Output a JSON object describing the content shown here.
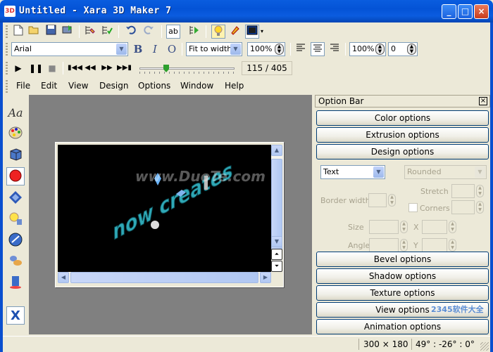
{
  "window": {
    "icon_text": "3D",
    "title": "Untitled - Xara 3D Maker 7",
    "minimize": "_",
    "maximize": "□",
    "close": "×"
  },
  "toolbar": {
    "icons": [
      "new-file-icon",
      "open-file-icon",
      "save-icon",
      "export-icon",
      "wizard-icon",
      "style-icon",
      "undo-icon",
      "redo-icon",
      "text-edit-icon",
      "animation-icon",
      "lightbulb-icon",
      "paint-icon",
      "view-mode-icon"
    ],
    "text_edit_label": "ab"
  },
  "format_bar": {
    "font": "Arial",
    "bold": "B",
    "italic": "I",
    "outline": "O",
    "fit_mode": "Fit to width",
    "zoom": "100%",
    "line_spacing": "100%",
    "kerning": "0"
  },
  "playback": {
    "frame_display": "115 / 405",
    "current_frame": 115,
    "total_frames": 405
  },
  "menu": {
    "items": [
      "File",
      "Edit",
      "View",
      "Design",
      "Options",
      "Window",
      "Help"
    ]
  },
  "left_tools": {
    "text_tool_label": "Aa",
    "icons": [
      "text-tool-icon",
      "color-palette-icon",
      "extrusion-icon",
      "record-icon",
      "bevel-icon",
      "light-icon",
      "rotation-icon",
      "texture-icon",
      "shadow-icon",
      "xara-logo-icon"
    ]
  },
  "canvas": {
    "text": "now creates",
    "overlay_watermark": "www.DuoTe.com"
  },
  "option_bar": {
    "title": "Option Bar",
    "close": "☒",
    "buttons_top": [
      "Color options",
      "Extrusion options",
      "Design options"
    ],
    "design": {
      "object_type": "Text",
      "corner_style": "Rounded",
      "stretch_label": "Stretch :",
      "border_width_label": "Border width :",
      "corners_label": "Corners :",
      "size_label": "Size",
      "x_label": "X",
      "angle_label": "Angle",
      "y_label": "Y"
    },
    "buttons_bottom": [
      "Bevel options",
      "Shadow options",
      "Texture options",
      "View options",
      "Animation options"
    ]
  },
  "status": {
    "dimensions": "300 × 180",
    "angles": "49° : -26° : 0°"
  },
  "watermark": "2345软件大全"
}
